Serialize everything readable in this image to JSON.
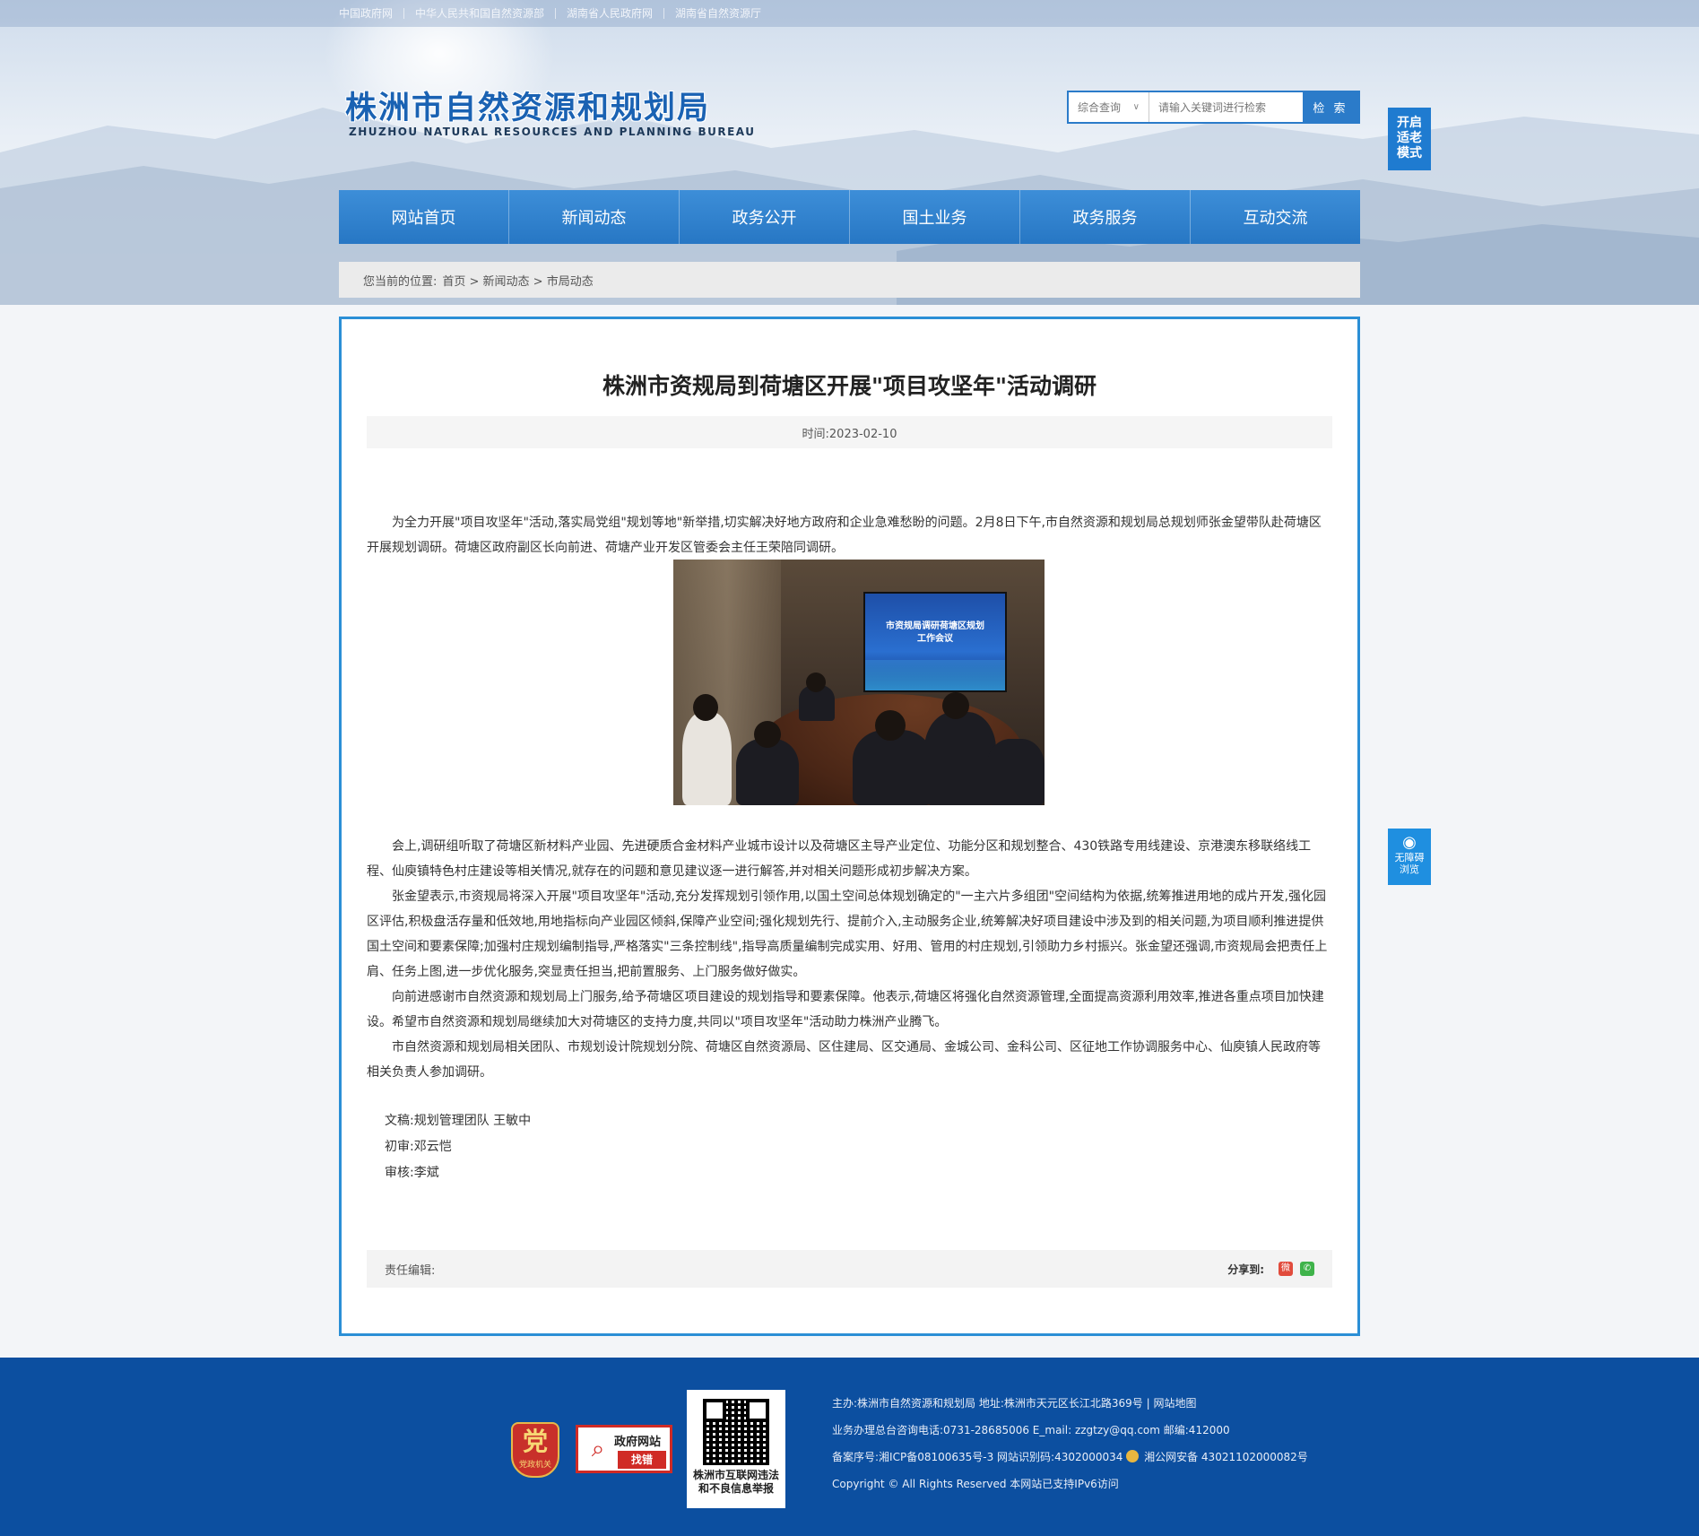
{
  "top_links": [
    "中国政府网",
    "中华人民共和国自然资源部",
    "湖南省人民政府网",
    "湖南省自然资源厅"
  ],
  "header": {
    "logo_cn": "株洲市自然资源和规划局",
    "logo_en": "ZHUZHOU NATURAL RESOURCES AND PLANNING BUREAU"
  },
  "search": {
    "scope": "综合查询",
    "placeholder": "请输入关键词进行检索",
    "button": "检 索"
  },
  "elder_mode": [
    "开启",
    "适老",
    "模式"
  ],
  "accessibility": [
    "无障碍",
    "浏览"
  ],
  "nav": [
    "网站首页",
    "新闻动态",
    "政务公开",
    "国土业务",
    "政务服务",
    "互动交流"
  ],
  "breadcrumb": {
    "label": "您当前的位置:",
    "path": "首页 > 新闻动态 > 市局动态"
  },
  "article": {
    "title": "株洲市资规局到荷塘区开展\"项目攻坚年\"活动调研",
    "date": "时间:2023-02-10",
    "photo_screen_text": [
      "市资规局调研荷塘区规划",
      "工作会议"
    ],
    "paragraphs": [
      "为全力开展\"项目攻坚年\"活动,落实局党组\"规划等地\"新举措,切实解决好地方政府和企业急难愁盼的问题。2月8日下午,市自然资源和规划局总规划师张金望带队赴荷塘区开展规划调研。荷塘区政府副区长向前进、荷塘产业开发区管委会主任王荣陪同调研。",
      "会上,调研组听取了荷塘区新材料产业园、先进硬质合金材料产业城市设计以及荷塘区主导产业定位、功能分区和规划整合、430铁路专用线建设、京港澳东移联络线工程、仙庾镇特色村庄建设等相关情况,就存在的问题和意见建议逐一进行解答,并对相关问题形成初步解决方案。",
      "张金望表示,市资规局将深入开展\"项目攻坚年\"活动,充分发挥规划引领作用,以国土空间总体规划确定的\"一主六片多组团\"空间结构为依据,统筹推进用地的成片开发,强化园区评估,积极盘活存量和低效地,用地指标向产业园区倾斜,保障产业空间;强化规划先行、提前介入,主动服务企业,统筹解决好项目建设中涉及到的相关问题,为项目顺利推进提供国土空间和要素保障;加强村庄规划编制指导,严格落实\"三条控制线\",指导高质量编制完成实用、好用、管用的村庄规划,引领助力乡村振兴。张金望还强调,市资规局会把责任上肩、任务上图,进一步优化服务,突显责任担当,把前置服务、上门服务做好做实。",
      "向前进感谢市自然资源和规划局上门服务,给予荷塘区项目建设的规划指导和要素保障。他表示,荷塘区将强化自然资源管理,全面提高资源利用效率,推进各重点项目加快建设。希望市自然资源和规划局继续加大对荷塘区的支持力度,共同以\"项目攻坚年\"活动助力株洲产业腾飞。",
      "市自然资源和规划局相关团队、市规划设计院规划分院、荷塘区自然资源局、区住建局、区交通局、金城公司、金科公司、区征地工作协调服务中心、仙庾镇人民政府等相关负责人参加调研。"
    ],
    "credits": [
      "文稿:规划管理团队 王敏中",
      "初审:邓云恺",
      "审核:李斌"
    ],
    "editor_label": "责任编辑:",
    "share_label": "分享到:"
  },
  "footer": {
    "badge1_big": "党",
    "badge1_small": "党政机关",
    "badge2_title": "政府网站",
    "badge2_sub": "找错",
    "qr_caption": [
      "株洲市互联网违法",
      "和不良信息举报"
    ],
    "lines": [
      "主办:株洲市自然资源和规划局  地址:株洲市天元区长江北路369号 | 网站地图",
      "业务办理总台咨询电话:0731-28685006    E_mail:    zzgtzy@qq.com    邮编:412000",
      "备案序号:湘ICP备08100635号-3 网站识别码:4302000034",
      "湘公网安备 43021102000082号",
      "Copyright © All Rights Reserved 本网站已支持IPv6访问"
    ]
  },
  "colors": {
    "brand_blue": "#2b7bc9",
    "footer_blue": "#0c4fa0",
    "content_border": "#2b8fd6"
  }
}
